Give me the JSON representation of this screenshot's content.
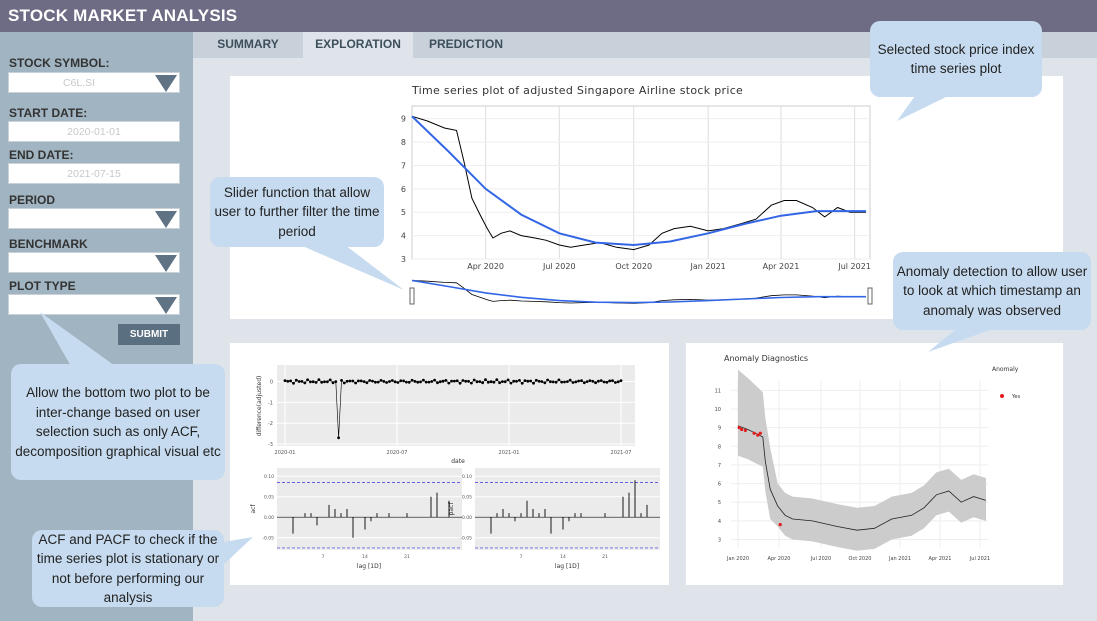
{
  "app": {
    "title": "STOCK MARKET ANALYSIS"
  },
  "sidebar": {
    "stock_symbol_label": "STOCK SYMBOL:",
    "stock_symbol_value": "C6L.SI",
    "start_date_label": "START DATE:",
    "start_date_value": "2020-01-01",
    "end_date_label": "END DATE:",
    "end_date_value": "2021-07-15",
    "period_label": "PERIOD",
    "period_value": "",
    "benchmark_label": "BENCHMARK",
    "benchmark_value": "",
    "plot_type_label": "PLOT TYPE",
    "plot_type_value": "",
    "submit_label": "SUBMIT"
  },
  "tabs": [
    {
      "label": "SUMMARY"
    },
    {
      "label": "EXPLORATION",
      "active": true
    },
    {
      "label": "PREDICTION"
    }
  ],
  "callouts": {
    "selected": "Selected stock price index time series plot",
    "slider": "Slider function that allow user to further filter the time period",
    "anomaly": "Anomaly detection to allow user to look at which timestamp an anomaly was observed",
    "interchange": "Allow the bottom two plot to be inter-change based on user selection such as only ACF, decomposition graphical visual etc",
    "acf": "ACF and PACF to check if the time series plot is stationary or not before performing our analysis"
  },
  "chart_data": [
    {
      "type": "line",
      "title": "Time series plot of adjusted Singapore Airline stock price",
      "x_ticks": [
        "Apr 2020",
        "Jul 2020",
        "Oct 2020",
        "Jan 2021",
        "Apr 2021",
        "Jul 2021"
      ],
      "y_ticks": [
        "3",
        "4",
        "5",
        "6",
        "7",
        "8",
        "9"
      ],
      "ylim": [
        3,
        9.2
      ],
      "series": [
        {
          "kind": "price",
          "color": "#000000",
          "x": [
            "2020-01-01",
            "2020-01-20",
            "2020-02-10",
            "2020-02-25",
            "2020-03-05",
            "2020-03-15",
            "2020-03-25",
            "2020-04-03",
            "2020-04-10",
            "2020-04-20",
            "2020-05-01",
            "2020-05-15",
            "2020-06-01",
            "2020-06-15",
            "2020-07-01",
            "2020-07-15",
            "2020-08-01",
            "2020-08-20",
            "2020-09-10",
            "2020-10-01",
            "2020-10-20",
            "2020-11-05",
            "2020-11-20",
            "2020-12-10",
            "2021-01-01",
            "2021-01-20",
            "2021-02-10",
            "2021-03-01",
            "2021-03-20",
            "2021-04-05",
            "2021-04-20",
            "2021-05-10",
            "2021-05-25",
            "2021-06-10",
            "2021-06-25",
            "2021-07-15"
          ],
          "y": [
            9.1,
            8.9,
            8.6,
            8.5,
            7.2,
            5.6,
            4.9,
            4.3,
            3.9,
            4.1,
            4.2,
            4.0,
            3.9,
            3.8,
            3.6,
            3.5,
            3.6,
            3.7,
            3.5,
            3.4,
            3.6,
            4.1,
            4.3,
            4.4,
            4.2,
            4.3,
            4.5,
            4.7,
            5.3,
            5.5,
            5.5,
            5.2,
            4.8,
            5.2,
            5.0,
            5.0
          ]
        },
        {
          "kind": "trend",
          "color": "#3366e6",
          "x": [
            "2020-01-01",
            "2020-02-15",
            "2020-04-01",
            "2020-05-15",
            "2020-07-01",
            "2020-08-15",
            "2020-10-01",
            "2020-11-15",
            "2021-01-01",
            "2021-02-15",
            "2021-04-01",
            "2021-05-15",
            "2021-07-15"
          ],
          "y": [
            9.1,
            7.6,
            6.0,
            4.9,
            4.1,
            3.7,
            3.6,
            3.75,
            4.1,
            4.5,
            4.85,
            5.05,
            5.05
          ]
        }
      ]
    },
    {
      "type": "scatter",
      "ylabel": "difference(adjusted)",
      "xlabel": "date",
      "x_ticks": [
        "2020-01",
        "2020-07",
        "2021-01",
        "2021-07"
      ],
      "y_ticks": [
        "0",
        "-1",
        "-2",
        "-3"
      ]
    },
    {
      "type": "bar",
      "title": "",
      "xlabel": "lag [1D]",
      "ylabel": "acf",
      "x_ticks": [
        "7",
        "14",
        "21"
      ],
      "y_ticks": [
        "0.10",
        "0.05",
        "0.00",
        "-0.05"
      ],
      "ylim": [
        -0.08,
        0.12
      ],
      "values": [
        0.0,
        -0.04,
        0.0,
        0.01,
        0.01,
        -0.02,
        0.0,
        0.03,
        0.02,
        0.01,
        0.02,
        -0.05,
        0.0,
        -0.03,
        -0.01,
        0.01,
        0.0,
        0.01,
        0.0,
        0.0,
        0.01,
        0.0,
        0.0,
        0.0,
        0.05,
        0.06,
        0.0,
        0.04,
        0.0
      ]
    },
    {
      "type": "bar",
      "title": "",
      "xlabel": "lag [1D]",
      "ylabel": "pacf",
      "x_ticks": [
        "7",
        "14",
        "21"
      ],
      "y_ticks": [
        "0.10",
        "0.05",
        "0.00",
        "-0.05"
      ],
      "ylim": [
        -0.08,
        0.12
      ],
      "values": [
        0.0,
        -0.04,
        0.01,
        0.02,
        0.01,
        -0.01,
        0.01,
        0.04,
        0.02,
        0.01,
        0.02,
        -0.04,
        0.0,
        -0.03,
        -0.01,
        0.01,
        0.01,
        0.0,
        0.0,
        0.0,
        0.01,
        0.0,
        0.0,
        0.05,
        0.06,
        0.09,
        0.01,
        0.03,
        0.0
      ]
    },
    {
      "type": "line",
      "title": "Anomaly Diagnostics",
      "legend_title": "Anomaly",
      "legend_item": "Yes",
      "legend_position": "right",
      "x_ticks": [
        "Jan 2020",
        "Apr 2020",
        "Jul 2020",
        "Oct 2020",
        "Jan 2021",
        "Apr 2021",
        "Jul 2021"
      ],
      "y_ticks": [
        "3",
        "4",
        "5",
        "6",
        "7",
        "8",
        "9",
        "10",
        "11"
      ],
      "ylim": [
        2.6,
        11.5
      ],
      "colors": {
        "line": "#222222",
        "band": "#cccccc",
        "anomaly": "#e31a1c"
      }
    }
  ]
}
